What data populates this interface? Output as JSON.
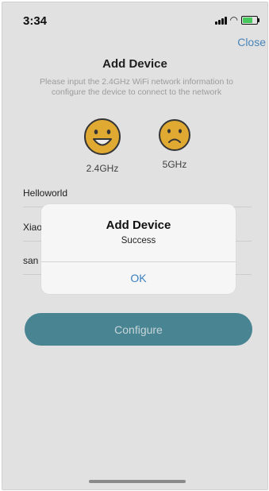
{
  "status_bar": {
    "time": "3:34"
  },
  "header": {
    "close_label": "Close",
    "title": "Add Device",
    "subtitle": "Please input the 2.4GHz WiFi network information to configure the device to connect to the network"
  },
  "bands": [
    {
      "label": "2.4GHz",
      "state": "happy"
    },
    {
      "label": "5GHz",
      "state": "sad"
    }
  ],
  "form": {
    "ssid_value": "Helloworld",
    "password_value": "Xiao",
    "extra_value": "san",
    "configure_label": "Configure"
  },
  "alert": {
    "title": "Add Device",
    "message": "Success",
    "ok_label": "OK"
  },
  "colors": {
    "accent_button": "#4e8e9e",
    "link_blue": "#3b7fc2",
    "face_yellow": "#f2b636",
    "battery_green": "#4cd964"
  }
}
